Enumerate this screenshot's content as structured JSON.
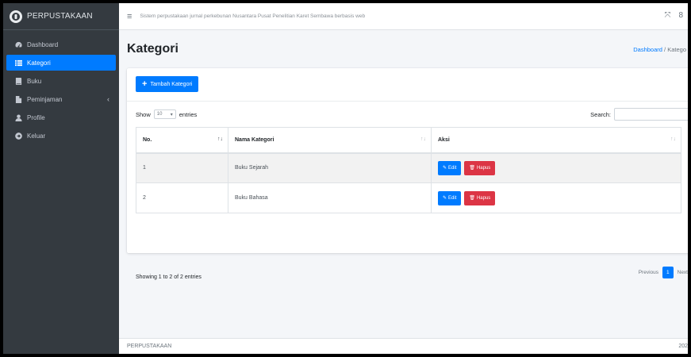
{
  "brand": {
    "title": "PERPUSTAKAAN"
  },
  "sidebar": {
    "items": [
      {
        "label": "Dashboard",
        "icon": "dashboard-icon"
      },
      {
        "label": "Kategori",
        "icon": "list-icon",
        "active": true
      },
      {
        "label": "Buku",
        "icon": "book-icon"
      },
      {
        "label": "Peminjaman",
        "icon": "document-icon",
        "caret": "‹"
      },
      {
        "label": "Profile",
        "icon": "user-icon"
      },
      {
        "label": "Keluar",
        "icon": "logout-icon"
      }
    ]
  },
  "topbar": {
    "menu_icon": "≡",
    "text": "Sistem perpustakaan jurnal perkebunan Nusantara Pusat Penelitian Karet Sembawa berbasis web",
    "expand_icon": "⤧",
    "user_icon": "8"
  },
  "page": {
    "title": "Kategori",
    "breadcrumb_home": "Dashboard",
    "breadcrumb_sep": "/",
    "breadcrumb_current": "Katego"
  },
  "card": {
    "add_button": "Tambah Kategori",
    "show_label": "Show",
    "length_value": "10",
    "entries_label": "entries",
    "search_label": "Search:"
  },
  "table": {
    "headers": [
      "No.",
      "Nama Kategori",
      "Aksi"
    ],
    "rows": [
      {
        "no": "1",
        "nama": "Buku Sejarah"
      },
      {
        "no": "2",
        "nama": "Buku Bahasa"
      }
    ],
    "edit_label": "Edit",
    "delete_label": "Hapus"
  },
  "info": "Showing 1 to 2 of 2 entries",
  "pagination": {
    "previous": "Previous",
    "current": "1",
    "next": "Next"
  },
  "footer": {
    "left": "PERPUSTAKAAN",
    "right": "202"
  },
  "colors": {
    "primary": "#007bff",
    "danger": "#dc3545",
    "sidebar": "#343a40"
  }
}
